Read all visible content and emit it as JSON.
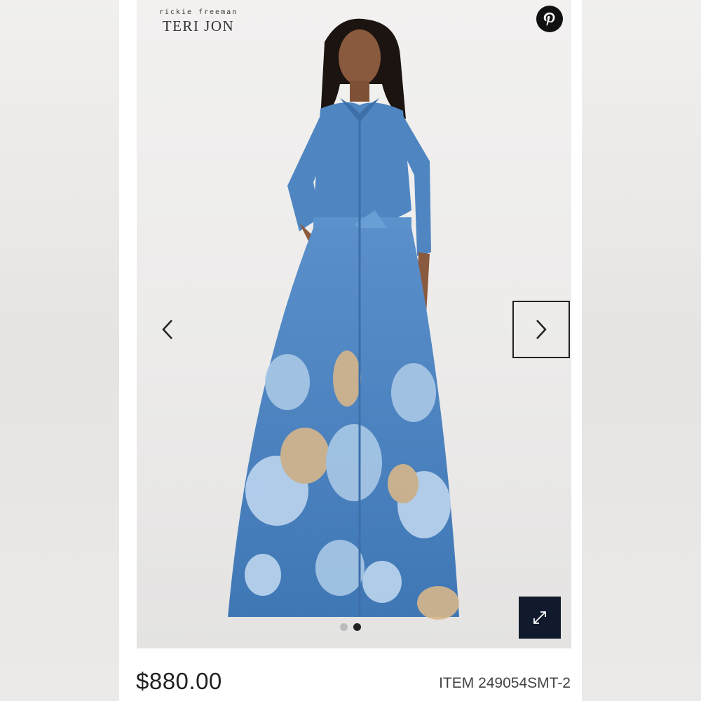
{
  "brand": {
    "sub": "rickie freeman",
    "name": "TERI JON"
  },
  "pinterest": {
    "icon": "pinterest-icon",
    "label": "Pin it"
  },
  "gallery": {
    "prev_icon": "chevron-left-icon",
    "next_icon": "chevron-right-icon",
    "expand_icon": "expand-icon",
    "image_count": 2,
    "active_index": 2,
    "image_alt": "Model wearing blue floral jacquard belted shirt gown"
  },
  "product": {
    "price": "$880.00",
    "item_code": "ITEM 249054SMT-2"
  },
  "colors": {
    "dress": "#4f86c2",
    "accent": "#101a2c",
    "floral": "#a9c8e6",
    "gold": "#d7b68a"
  }
}
